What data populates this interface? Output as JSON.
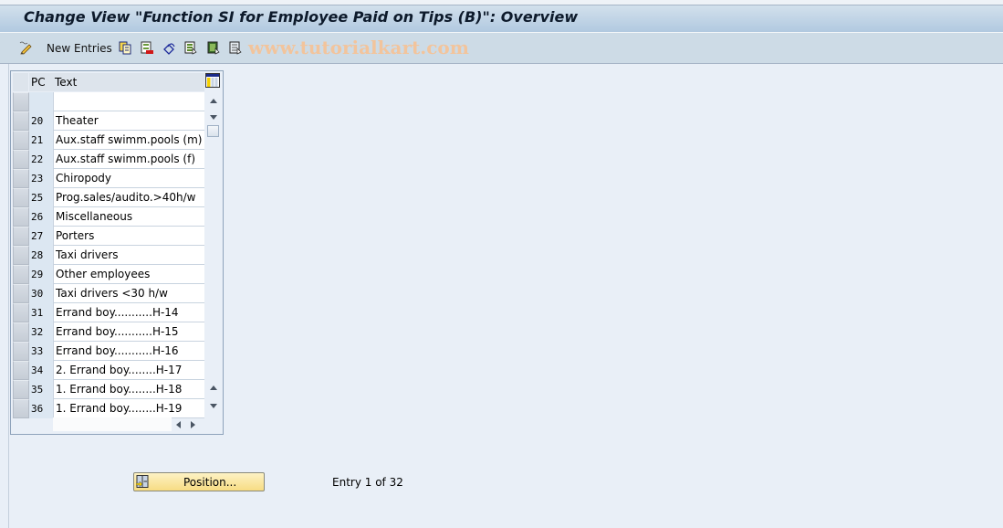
{
  "window": {
    "title": "Change View \"Function SI for Employee Paid on Tips (B)\": Overview"
  },
  "toolbar": {
    "items": [
      {
        "icon": "edit-pencil-icon",
        "label": "New Entries"
      },
      {
        "icon": "copy-as-icon",
        "label": ""
      },
      {
        "icon": "delete-icon",
        "label": ""
      },
      {
        "icon": "undo-change-icon",
        "label": ""
      },
      {
        "icon": "select-all-icon",
        "label": ""
      },
      {
        "icon": "select-block-icon",
        "label": ""
      },
      {
        "icon": "deselect-all-icon",
        "label": ""
      }
    ],
    "watermark": "www.tutorialkart.com"
  },
  "table": {
    "columns": [
      "PC",
      "Text"
    ],
    "rows": [
      {
        "pc": "",
        "text": ""
      },
      {
        "pc": "20",
        "text": "Theater"
      },
      {
        "pc": "21",
        "text": "Aux.staff swimm.pools (m)"
      },
      {
        "pc": "22",
        "text": "Aux.staff swimm.pools (f)"
      },
      {
        "pc": "23",
        "text": "Chiropody"
      },
      {
        "pc": "25",
        "text": "Prog.sales/audito.>40h/w"
      },
      {
        "pc": "26",
        "text": "Miscellaneous"
      },
      {
        "pc": "27",
        "text": "Porters"
      },
      {
        "pc": "28",
        "text": "Taxi drivers"
      },
      {
        "pc": "29",
        "text": "Other employees"
      },
      {
        "pc": "30",
        "text": "Taxi drivers <30 h/w"
      },
      {
        "pc": "31",
        "text": "Errand boy...........H-14"
      },
      {
        "pc": "32",
        "text": "Errand boy...........H-15"
      },
      {
        "pc": "33",
        "text": "Errand boy...........H-16"
      },
      {
        "pc": "34",
        "text": "2. Errand boy........H-17"
      },
      {
        "pc": "35",
        "text": "1. Errand boy........H-18"
      },
      {
        "pc": "36",
        "text": "1. Errand boy........H-19"
      }
    ]
  },
  "footer": {
    "position_button": "Position...",
    "entry_info": "Entry 1 of 32"
  }
}
